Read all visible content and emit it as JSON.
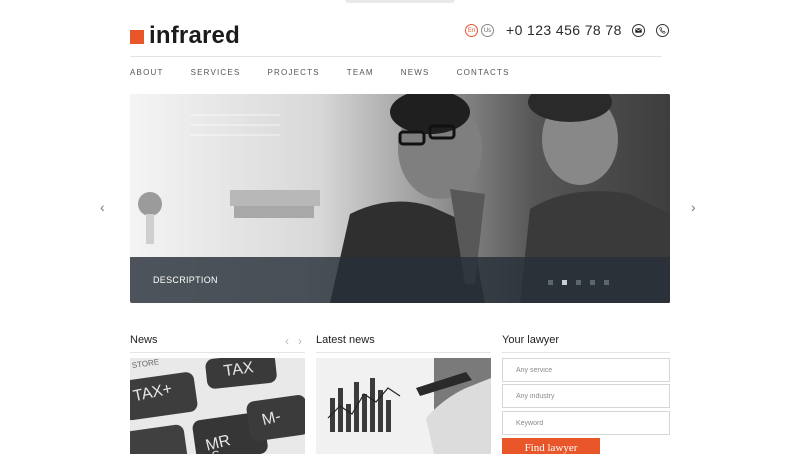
{
  "brand": {
    "name": "infrared",
    "accent": "#e8562a"
  },
  "header": {
    "lang_en": "En",
    "lang_us": "Us",
    "phone": "+0 123 456 78 78",
    "icons": [
      "envelope-icon",
      "phone-icon"
    ]
  },
  "nav": {
    "items": [
      {
        "label": "ABOUT"
      },
      {
        "label": "SERVICES"
      },
      {
        "label": "PROJECTS"
      },
      {
        "label": "TEAM"
      },
      {
        "label": "NEWS"
      },
      {
        "label": "CONTACTS"
      }
    ]
  },
  "slider": {
    "caption": "DESCRIPTION",
    "slide_count": 5,
    "active_slide": 2,
    "prev_icon": "‹",
    "next_icon": "›"
  },
  "news": {
    "title": "News",
    "prev_icon": "‹",
    "next_icon": "›"
  },
  "latest": {
    "title": "Latest news"
  },
  "lawyer": {
    "title": "Your lawyer",
    "service_placeholder": "Any service",
    "industry_placeholder": "Any industry",
    "keyword_placeholder": "Keyword",
    "button": "Find lawyer"
  }
}
